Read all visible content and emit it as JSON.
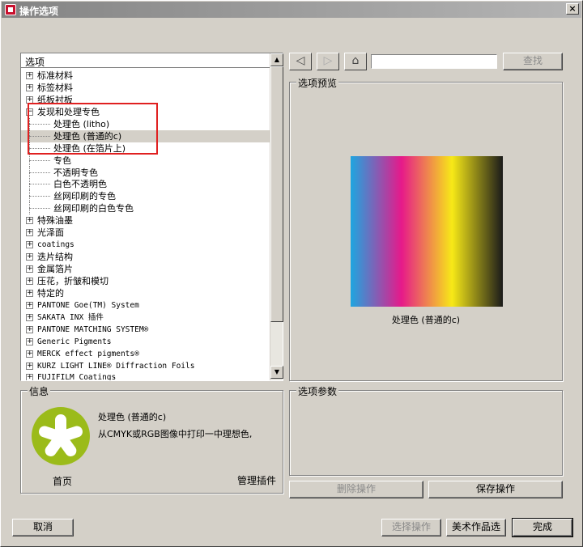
{
  "window": {
    "title": "操作选项",
    "close_label": "×"
  },
  "tree": {
    "header": "选项",
    "items": [
      {
        "label": "标准材料",
        "kind": "parent",
        "expander": "+"
      },
      {
        "label": "标签材料",
        "kind": "parent",
        "expander": "+"
      },
      {
        "label": "纸板衬板",
        "kind": "parent",
        "expander": "+"
      },
      {
        "label": "发现和处理专色",
        "kind": "parent",
        "expander": "−"
      },
      {
        "label": "处理色 (litho)",
        "kind": "child"
      },
      {
        "label": "处理色 (普通的c)",
        "kind": "child",
        "selected": true
      },
      {
        "label": "处理色 (在箔片上)",
        "kind": "child"
      },
      {
        "label": "专色",
        "kind": "child"
      },
      {
        "label": "不透明专色",
        "kind": "child"
      },
      {
        "label": "白色不透明色",
        "kind": "child"
      },
      {
        "label": "丝网印刷的专色",
        "kind": "child"
      },
      {
        "label": "丝网印刷的白色专色",
        "kind": "child"
      },
      {
        "label": "特殊油墨",
        "kind": "parent",
        "expander": "+"
      },
      {
        "label": "光泽面",
        "kind": "parent",
        "expander": "+"
      },
      {
        "label": "coatings",
        "kind": "parent",
        "expander": "+",
        "mono": true
      },
      {
        "label": "迭片结构",
        "kind": "parent",
        "expander": "+"
      },
      {
        "label": "金属箔片",
        "kind": "parent",
        "expander": "+"
      },
      {
        "label": "压花，折皱和模切",
        "kind": "parent",
        "expander": "+"
      },
      {
        "label": "特定的",
        "kind": "parent",
        "expander": "+"
      },
      {
        "label": "PANTONE Goe(TM) System",
        "kind": "parent",
        "expander": "+",
        "mono": true
      },
      {
        "label": "SAKATA INX 插件",
        "kind": "parent",
        "expander": "+",
        "mono": true
      },
      {
        "label": "PANTONE MATCHING SYSTEM®",
        "kind": "parent",
        "expander": "+",
        "mono": true
      },
      {
        "label": "Generic Pigments",
        "kind": "parent",
        "expander": "+",
        "mono": true
      },
      {
        "label": "MERCK effect pigments®",
        "kind": "parent",
        "expander": "+",
        "mono": true
      },
      {
        "label": "KURZ LIGHT LINE® Diffraction Foils",
        "kind": "parent",
        "expander": "+",
        "mono": true
      },
      {
        "label": "FUJIFILM Coatings",
        "kind": "parent",
        "expander": "+",
        "mono": true
      }
    ],
    "scroll_up_icon": "▲",
    "scroll_down_icon": "▼"
  },
  "toolbar": {
    "back_icon": "◁",
    "forward_icon": "▷",
    "home_icon": "⌂",
    "search_placeholder": "",
    "search_button": "查找"
  },
  "preview": {
    "legend": "选项预览",
    "caption": "处理色 (普通的c)",
    "gradient_colors": [
      "#1ea6e0",
      "#e6198a",
      "#f7e917",
      "#1a1a1a"
    ]
  },
  "info": {
    "legend": "信息",
    "title": "处理色 (普通的c)",
    "description": "从CMYK或RGB图像中打印一中理想色,",
    "home_label": "首页",
    "manage_label": "管理插件",
    "logo_color": "#9bbb1a"
  },
  "params": {
    "legend": "选项参数",
    "delete_button": "删除操作",
    "save_button": "保存操作"
  },
  "footer": {
    "cancel_button": "取消",
    "select_button": "选择操作",
    "artwork_button": "美术作品选",
    "done_button": "完成"
  }
}
